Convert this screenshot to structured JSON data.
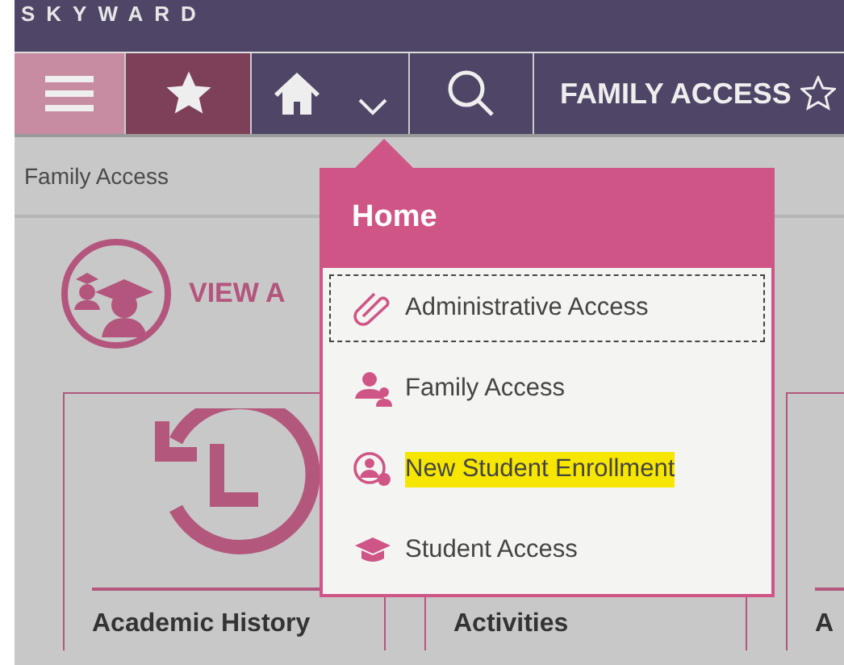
{
  "brand": "SKYWARD",
  "nav": {
    "title": "FAMILY ACCESS"
  },
  "breadcrumb": "Family Access",
  "view_all": "VIEW A",
  "cards": [
    {
      "label": "Academic History",
      "kind": "history"
    },
    {
      "label": "Activities",
      "kind": "hidden"
    },
    {
      "label": "A",
      "kind": "hidden"
    }
  ],
  "dropdown": {
    "title": "Home",
    "items": [
      {
        "label": "Administrative Access",
        "kind": "clip",
        "focused": true,
        "highlighted": false
      },
      {
        "label": "Family Access",
        "kind": "family",
        "focused": false,
        "highlighted": false
      },
      {
        "label": "New Student Enrollment",
        "kind": "enroll",
        "focused": false,
        "highlighted": true
      },
      {
        "label": "Student Access",
        "kind": "cap",
        "focused": false,
        "highlighted": false
      }
    ]
  }
}
